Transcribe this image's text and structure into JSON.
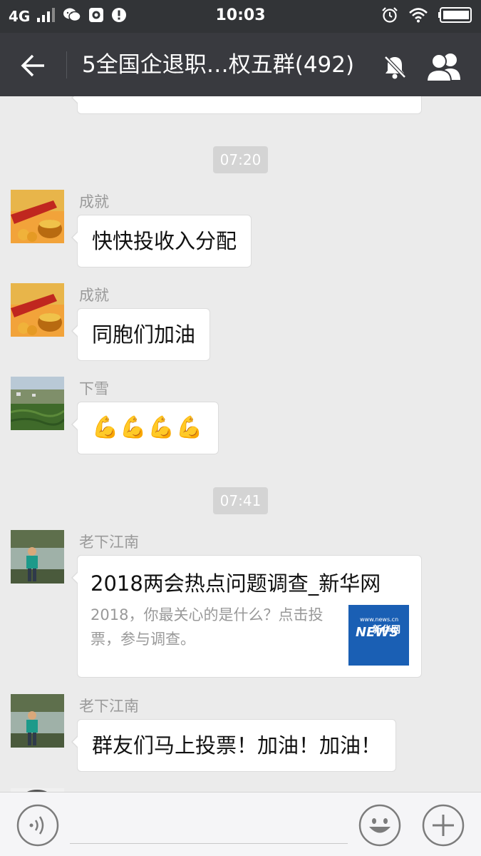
{
  "status_bar": {
    "network": "4G",
    "time": "10:03"
  },
  "header": {
    "title": "5全国企退职…权五群(492)"
  },
  "messages": [
    {
      "type": "time",
      "text": "07:20"
    },
    {
      "type": "text",
      "sender": "成就",
      "text": "快快投收入分配"
    },
    {
      "type": "text",
      "sender": "成就",
      "text": "同胞们加油"
    },
    {
      "type": "emoji",
      "sender": "下雪",
      "text": "💪💪💪💪"
    },
    {
      "type": "time",
      "text": "07:41"
    },
    {
      "type": "link",
      "sender": "老下江南",
      "title": "2018两会热点问题调查_新华网",
      "description": "2018，你最关心的是什么？点击投票，参与调查。",
      "thumb_site": "www.news.cn",
      "thumb_brand": "新华网",
      "thumb_logo": "NEWS"
    },
    {
      "type": "text",
      "sender": "老下江南",
      "text": "群友们马上投票！加油！加油！"
    }
  ],
  "colors": {
    "status_bar": "#323437",
    "title_bar": "#393a3f",
    "chat_bg": "#ebebeb",
    "time_chip": "#d4d4d4",
    "news_blue": "#1a5fb4"
  }
}
